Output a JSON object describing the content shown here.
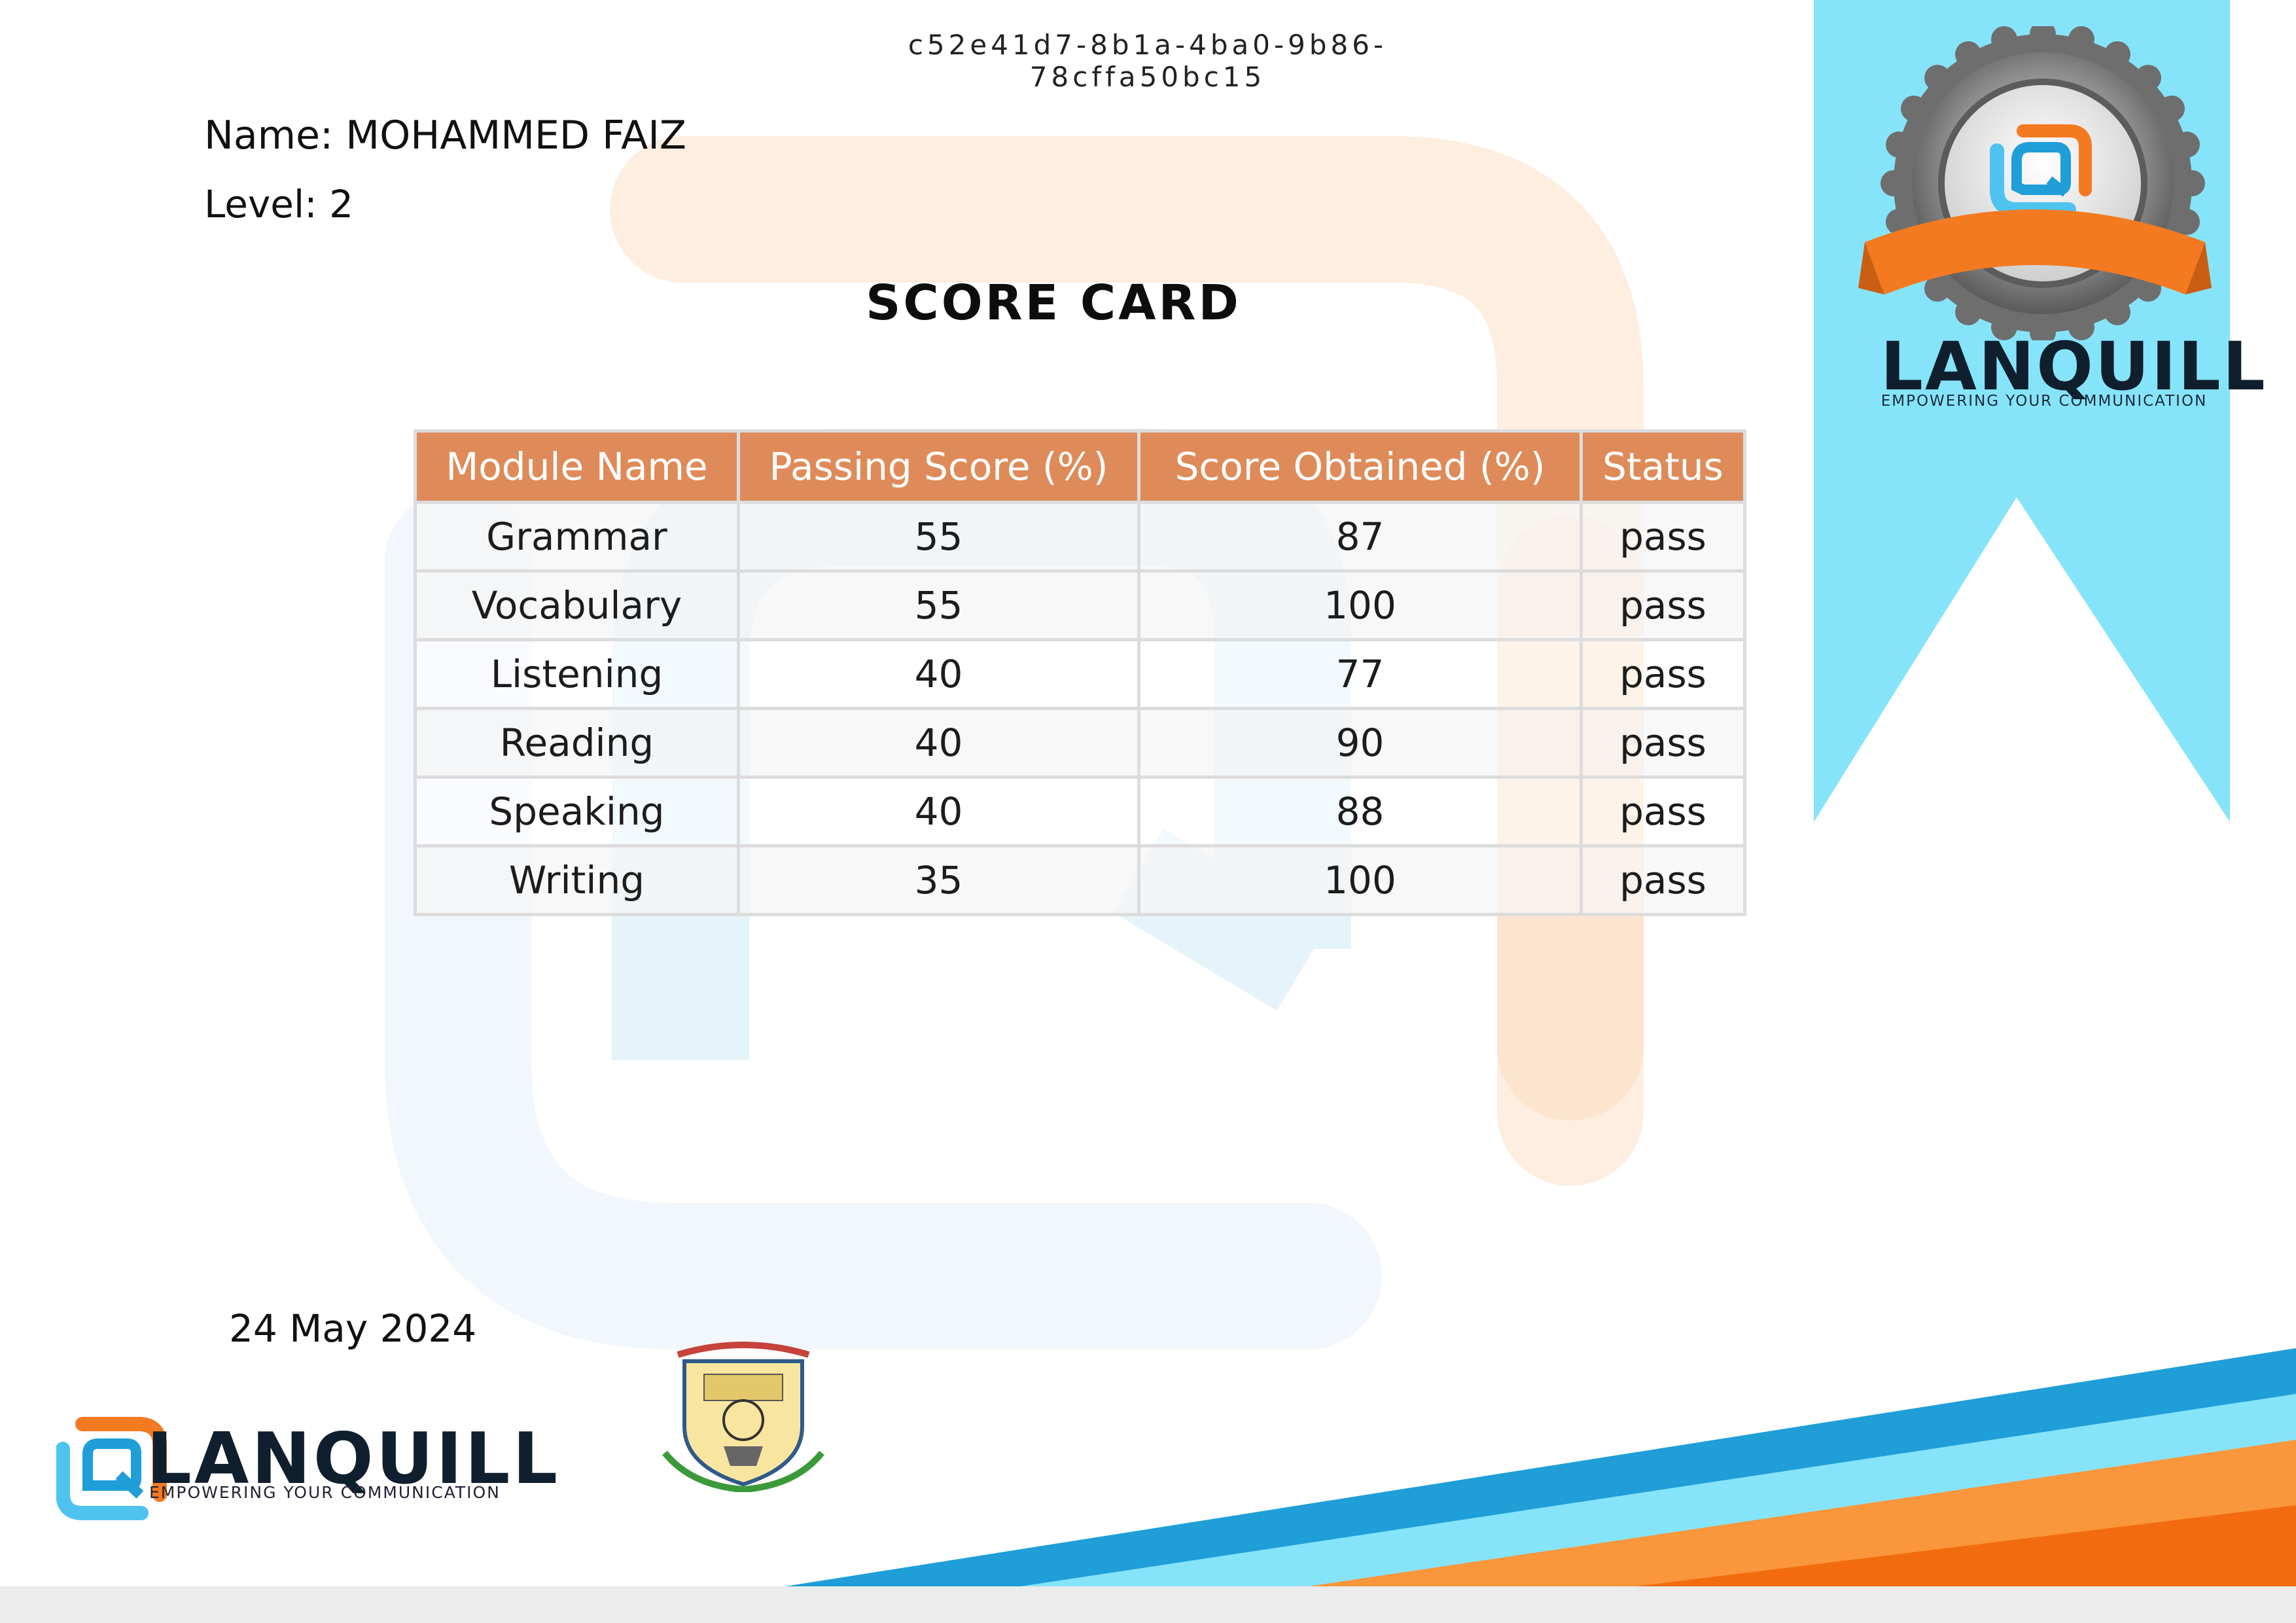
{
  "certificate": {
    "id": "c52e41d7-8b1a-4ba0-9b86-78cffa50bc15",
    "name_line": "Name: MOHAMMED FAIZ",
    "level_line": "Level: 2",
    "title": "SCORE CARD",
    "date": "24 May 2024"
  },
  "table": {
    "headers": [
      "Module Name",
      "Passing Score (%)",
      "Score Obtained (%)",
      "Status"
    ],
    "rows": [
      [
        "Grammar",
        "55",
        "87",
        "pass"
      ],
      [
        "Vocabulary",
        "55",
        "100",
        "pass"
      ],
      [
        "Listening",
        "40",
        "77",
        "pass"
      ],
      [
        "Reading",
        "40",
        "90",
        "pass"
      ],
      [
        "Speaking",
        "40",
        "88",
        "pass"
      ],
      [
        "Writing",
        "35",
        "100",
        "pass"
      ]
    ]
  },
  "brand": {
    "name": "LANQUILL",
    "tagline": "EMPOWERING YOUR COMMUNICATION"
  },
  "icons": {
    "badge": "award-badge-icon",
    "logo": "lanquill-logo-icon",
    "emblem": "college-emblem-icon"
  },
  "colors": {
    "header_orange": "#de8b59",
    "ribbon_blue": "#86e4fa",
    "stripe_blue": "#1f9ed8",
    "stripe_orange": "#f7801f"
  }
}
